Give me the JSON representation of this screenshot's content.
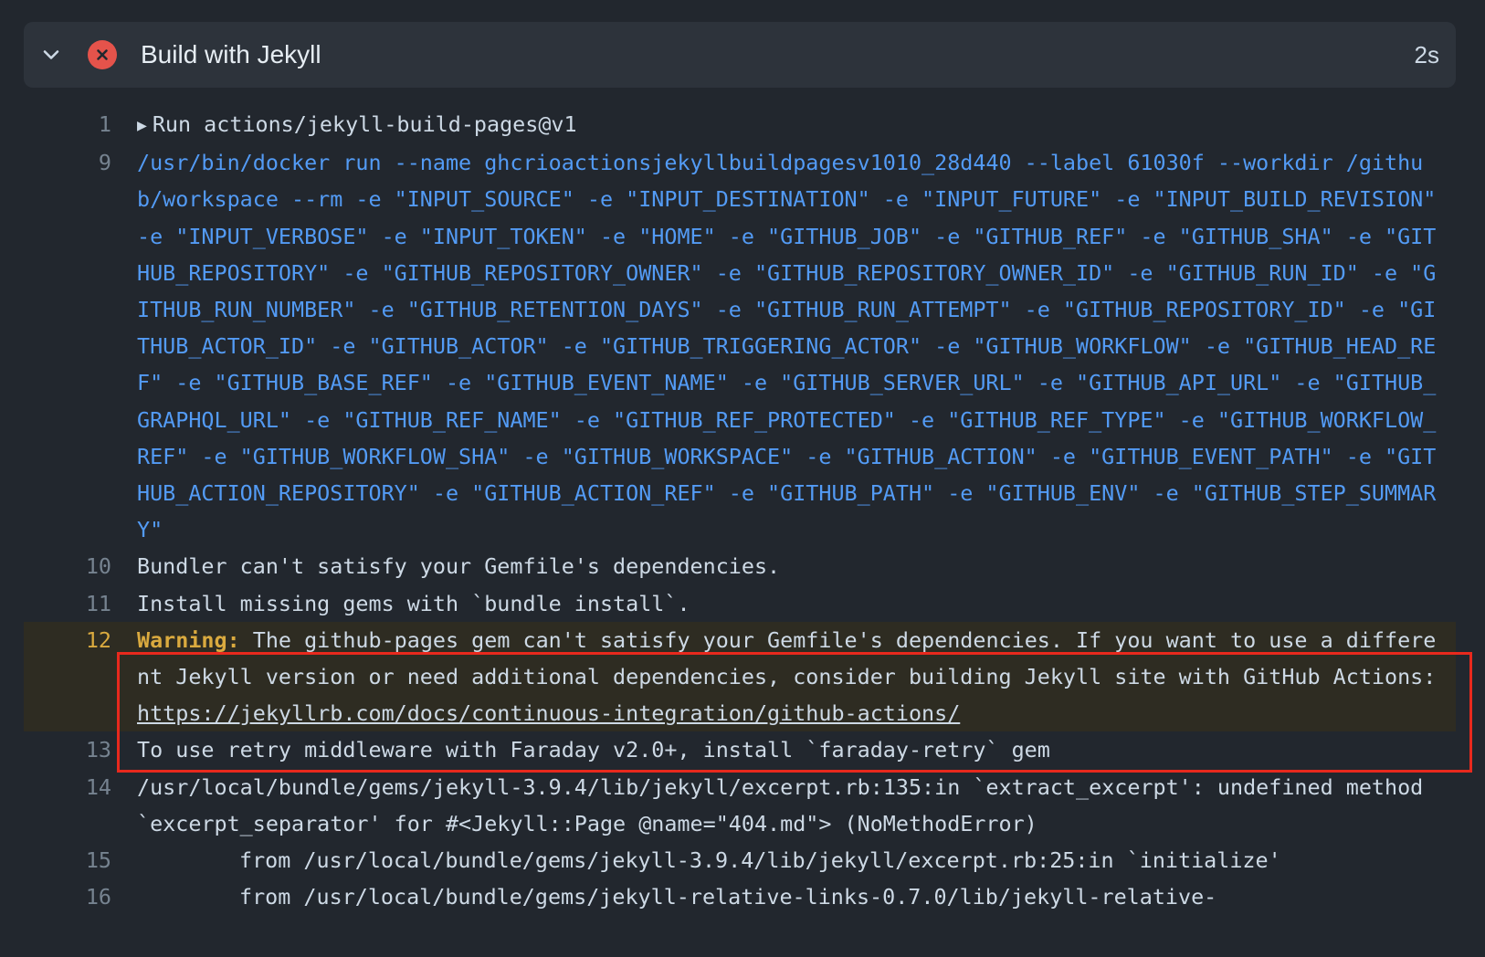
{
  "step": {
    "title": "Build with Jekyll",
    "duration": "2s",
    "status": "failed",
    "icons": {
      "expand": "chevron-down-icon",
      "status": "x-circle-icon"
    }
  },
  "colors": {
    "command": "#539bf5",
    "warning": "#daaa3f",
    "error_icon": "#e5534b",
    "highlight_box": "#e8291d"
  },
  "log": {
    "line1": {
      "num": "1",
      "text": "Run actions/jekyll-build-pages@v1"
    },
    "line9": {
      "num": "9",
      "text": "/usr/bin/docker run --name ghcrioactionsjekyllbuildpagesv1010_28d440 --label 61030f --workdir /github/workspace --rm -e \"INPUT_SOURCE\" -e \"INPUT_DESTINATION\" -e \"INPUT_FUTURE\" -e \"INPUT_BUILD_REVISION\" -e \"INPUT_VERBOSE\" -e \"INPUT_TOKEN\" -e \"HOME\" -e \"GITHUB_JOB\" -e \"GITHUB_REF\" -e \"GITHUB_SHA\" -e \"GITHUB_REPOSITORY\" -e \"GITHUB_REPOSITORY_OWNER\" -e \"GITHUB_REPOSITORY_OWNER_ID\" -e \"GITHUB_RUN_ID\" -e \"GITHUB_RUN_NUMBER\" -e \"GITHUB_RETENTION_DAYS\" -e \"GITHUB_RUN_ATTEMPT\" -e \"GITHUB_REPOSITORY_ID\" -e \"GITHUB_ACTOR_ID\" -e \"GITHUB_ACTOR\" -e \"GITHUB_TRIGGERING_ACTOR\" -e \"GITHUB_WORKFLOW\" -e \"GITHUB_HEAD_REF\" -e \"GITHUB_BASE_REF\" -e \"GITHUB_EVENT_NAME\" -e \"GITHUB_SERVER_URL\" -e \"GITHUB_API_URL\" -e \"GITHUB_GRAPHQL_URL\" -e \"GITHUB_REF_NAME\" -e \"GITHUB_REF_PROTECTED\" -e \"GITHUB_REF_TYPE\" -e \"GITHUB_WORKFLOW_REF\" -e \"GITHUB_WORKFLOW_SHA\" -e \"GITHUB_WORKSPACE\" -e \"GITHUB_ACTION\" -e \"GITHUB_EVENT_PATH\" -e \"GITHUB_ACTION_REPOSITORY\" -e \"GITHUB_ACTION_REF\" -e \"GITHUB_PATH\" -e \"GITHUB_ENV\" -e \"GITHUB_STEP_SUMMARY\""
    },
    "line10": {
      "num": "10",
      "text": "Bundler can't satisfy your Gemfile's dependencies."
    },
    "line11": {
      "num": "11",
      "text": "Install missing gems with `bundle install`."
    },
    "line12": {
      "num": "12",
      "label": "Warning:",
      "text": " The github-pages gem can't satisfy your Gemfile's dependencies. If you want to use a different Jekyll version or need additional dependencies, consider building Jekyll site with GitHub Actions: ",
      "link": "https://jekyllrb.com/docs/continuous-integration/github-actions/"
    },
    "line13": {
      "num": "13",
      "text": "To use retry middleware with Faraday v2.0+, install `faraday-retry` gem"
    },
    "line14": {
      "num": "14",
      "text": "/usr/local/bundle/gems/jekyll-3.9.4/lib/jekyll/excerpt.rb:135:in `extract_excerpt': undefined method `excerpt_separator' for #<Jekyll::Page @name=\"404.md\"> (NoMethodError)"
    },
    "line15": {
      "num": "15",
      "text": "from /usr/local/bundle/gems/jekyll-3.9.4/lib/jekyll/excerpt.rb:25:in `initialize'"
    },
    "line16": {
      "num": "16",
      "text": "from /usr/local/bundle/gems/jekyll-relative-links-0.7.0/lib/jekyll-relative-"
    }
  }
}
